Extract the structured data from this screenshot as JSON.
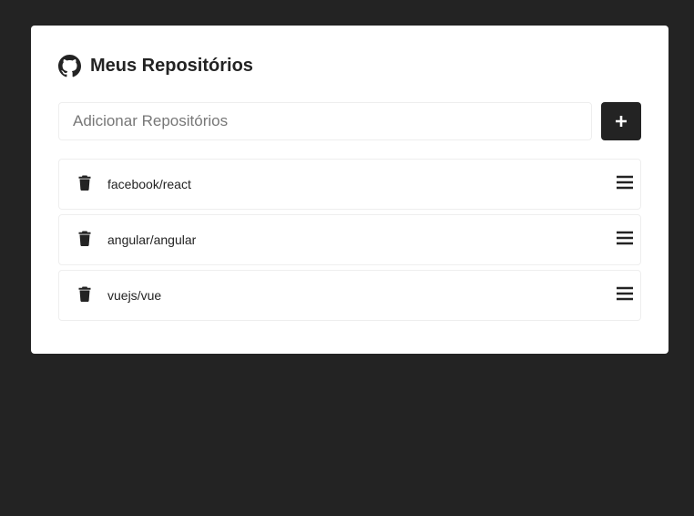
{
  "header": {
    "title": "Meus Repositórios",
    "icon": "github-icon"
  },
  "form": {
    "placeholder": "Adicionar Repositórios",
    "value": "",
    "add_icon": "plus-icon"
  },
  "repositories": [
    {
      "name": "facebook/react"
    },
    {
      "name": "angular/angular"
    },
    {
      "name": "vuejs/vue"
    }
  ],
  "colors": {
    "background": "#232323",
    "card": "#ffffff",
    "border": "#eeeeee",
    "button": "#232323"
  }
}
